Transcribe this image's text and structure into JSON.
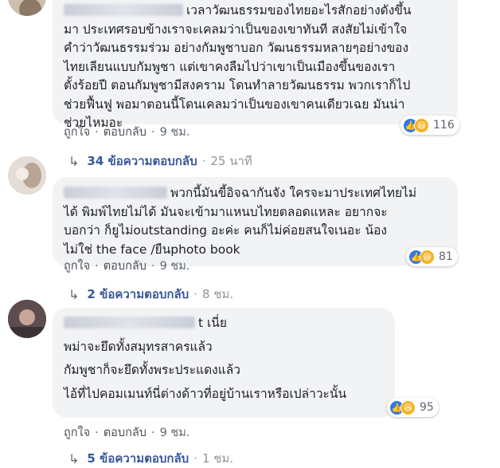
{
  "comments": [
    {
      "text_lines": [
        "เวลาวัฒนธรรมของไทยอะไรสักอย่างดังขึ้น",
        "มา ประเทศรอบข้างเราจะเคลมว่าเป็นของเขาทันที สงสัยไม่เข้าใจ",
        "คำว่าวัฒนธรรมร่วม อย่างกัมพูชาบอก วัฒนธรรมหลายๆอย่างของ",
        "ไทยเลียนแบบกัมพูชา แต่เขาคงลืมไปว่าเขาเป็นเมืองขึ้นของเรา",
        "ตั้งร้อยปี ตอนกัมพูชามีสงคราม โดนทำลายวัฒนธรรม พวกเราก็ไป",
        "ช่วยฟื้นฟู พอมาตอนนี้โดนเคลมว่าเป็นของเขาคนเดียวเฉย มันน่า",
        "ช่วยไหมอะ"
      ],
      "reaction_count": "116",
      "like_label": "ถูกใจ",
      "reply_label": "ตอบกลับ",
      "time": "9 ชม.",
      "replies_label": "34 ข้อความตอบกลับ",
      "replies_time": "25 นาที"
    },
    {
      "text_lines": [
        "พวกนี้มันขี้อิจฉากันจัง ใครจะมาประเทศไทยไม่",
        "ได้ พิมพ์ไทยไม่ได้ มันจะเข้ามาแหนบไทยตลอดแหละ อยากจะ",
        "บอกว่า ก็ยูไม่outstanding อะค่ะ คนก็ไม่ค่อยสนใจเนอะ น้อง",
        "ไม่ใช่ the face /ยืนphoto book"
      ],
      "reaction_count": "81",
      "like_label": "ถูกใจ",
      "reply_label": "ตอบกลับ",
      "time": "9 ชม.",
      "replies_label": "2 ข้อความตอบกลับ",
      "replies_time": "8 ชม."
    },
    {
      "name_tail": "t เนี่ย",
      "text_lines": [
        "พม่าจะยึดทั้งสมุทรสาครแล้ว",
        "กัมพูชาก็จะยึดทั้งพระประแดงแล้ว",
        "ไอ้ที่ไปคอมเมนท์นี่ต่างด้าวที่อยู่บ้านเราหรือเปล่าวะนั้น"
      ],
      "reaction_count": "95",
      "like_label": "ถูกใจ",
      "reply_label": "ตอบกลับ",
      "time": "9 ชม.",
      "replies_label": "5 ข้อความตอบกลับ",
      "replies_time": "1 ชม."
    }
  ],
  "icons": {
    "like": "like-icon",
    "haha": "haha-icon",
    "reply_arrow": "reply-arrow-icon"
  },
  "colors": {
    "bubble": "#f2f3f5",
    "link": "#385898",
    "like_blue": "#3578e5",
    "haha_yellow": "#f7b125"
  }
}
